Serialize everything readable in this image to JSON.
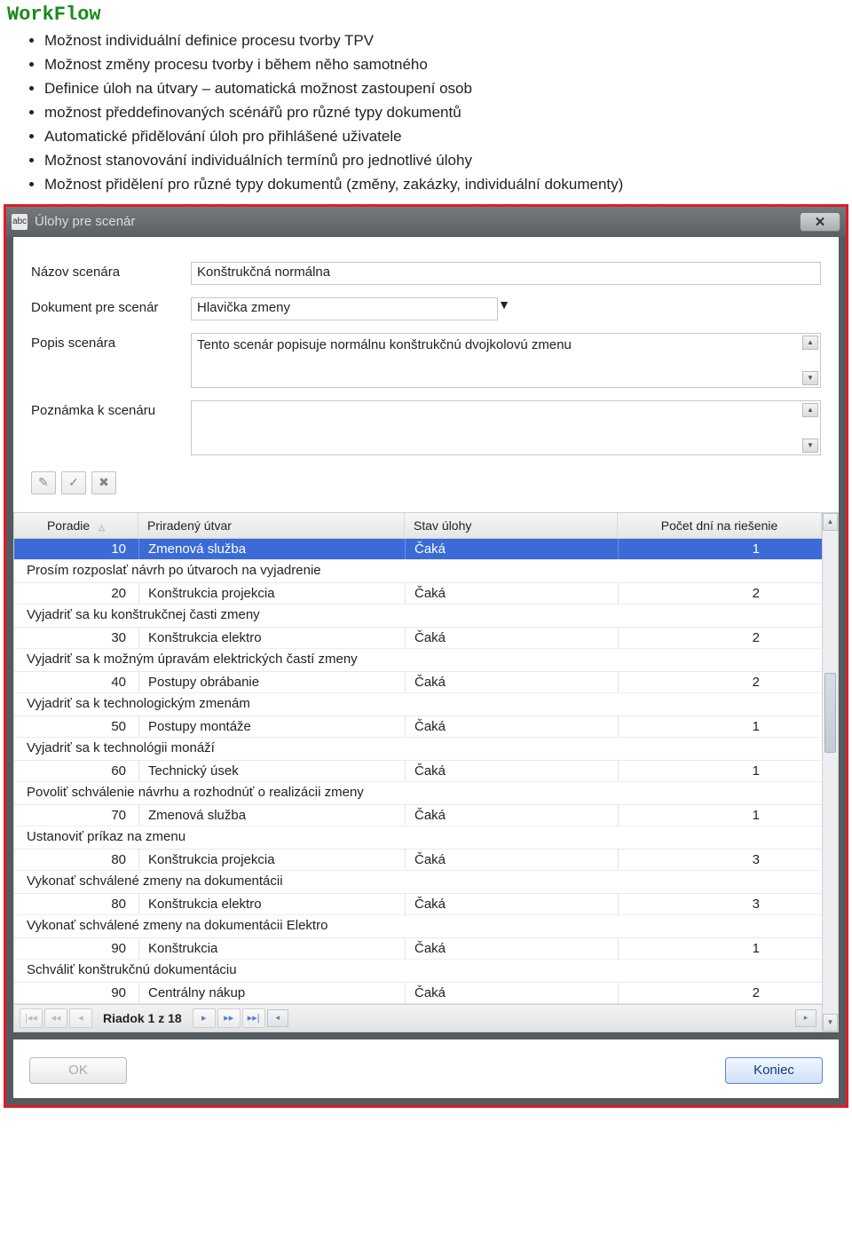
{
  "doc": {
    "title": "WorkFlow",
    "bullets": [
      "Možnost individuální definice procesu tvorby TPV",
      "Možnost změny procesu tvorby i během něho samotného",
      "Definice úloh na útvary – automatická možnost zastoupení osob",
      "možnost předdefinovaných scénářů pro různé typy dokumentů",
      "Automatické přidělování úloh pro přihlášené uživatele",
      "Možnost stanovování individuálních termínů pro jednotlivé úlohy",
      "Možnost přidělení pro různé typy dokumentů (změny, zakázky, individuální dokumenty)"
    ]
  },
  "window": {
    "title": "Úlohy pre scenár",
    "closeSymbol": "✕"
  },
  "form": {
    "labels": {
      "nazov": "Názov scenára",
      "dokument": "Dokument pre scenár",
      "popis": "Popis scenára",
      "poznamka": "Poznámka k scenáru"
    },
    "values": {
      "nazov": "Konštrukčná normálna",
      "dokument": "Hlavička zmeny",
      "popis": "Tento scenár popisuje normálnu konštrukčnú dvojkolovú zmenu",
      "poznamka": ""
    }
  },
  "icons": {
    "edit": "✎",
    "confirm": "✓",
    "delete": "✖"
  },
  "grid": {
    "headers": {
      "poradie": "Poradie",
      "utvar": "Priradený útvar",
      "stav": "Stav úlohy",
      "dni": "Počet dní na riešenie"
    },
    "rows": [
      {
        "poradie": 10,
        "utvar": "Zmenová služba",
        "stav": "Čaká",
        "dni": 1,
        "desc": "Prosím rozposlať návrh po útvaroch na vyjadrenie",
        "selected": true
      },
      {
        "poradie": 20,
        "utvar": "Konštrukcia projekcia",
        "stav": "Čaká",
        "dni": 2,
        "desc": "Vyjadriť sa  ku konštrukčnej časti zmeny"
      },
      {
        "poradie": 30,
        "utvar": "Konštrukcia elektro",
        "stav": "Čaká",
        "dni": 2,
        "desc": "Vyjadriť sa k možným úpravám elektrických častí zmeny"
      },
      {
        "poradie": 40,
        "utvar": "Postupy obrábanie",
        "stav": "Čaká",
        "dni": 2,
        "desc": "Vyjadriť sa k technologickým zmenám"
      },
      {
        "poradie": 50,
        "utvar": "Postupy montáže",
        "stav": "Čaká",
        "dni": 1,
        "desc": "Vyjadriť sa k technológii monáží"
      },
      {
        "poradie": 60,
        "utvar": "Technický úsek",
        "stav": "Čaká",
        "dni": 1,
        "desc": "Povoliť schválenie návrhu a rozhodnúť o realizácii zmeny"
      },
      {
        "poradie": 70,
        "utvar": "Zmenová služba",
        "stav": "Čaká",
        "dni": 1,
        "desc": "Ustanoviť príkaz na zmenu"
      },
      {
        "poradie": 80,
        "utvar": "Konštrukcia projekcia",
        "stav": "Čaká",
        "dni": 3,
        "desc": "Vykonať schválené zmeny na dokumentácii"
      },
      {
        "poradie": 80,
        "utvar": "Konštrukcia elektro",
        "stav": "Čaká",
        "dni": 3,
        "desc": "Vykonať schválené zmeny na dokumentácii Elektro"
      },
      {
        "poradie": 90,
        "utvar": "Konštrukcia",
        "stav": "Čaká",
        "dni": 1,
        "desc": "Schváliť konštrukčnú dokumentáciu"
      },
      {
        "poradie": 90,
        "utvar": "Centrálny nákup",
        "stav": "Čaká",
        "dni": 2
      }
    ]
  },
  "nav": {
    "label": "Riadok 1 z 18"
  },
  "footer": {
    "ok": "OK",
    "koniec": "Koniec"
  }
}
